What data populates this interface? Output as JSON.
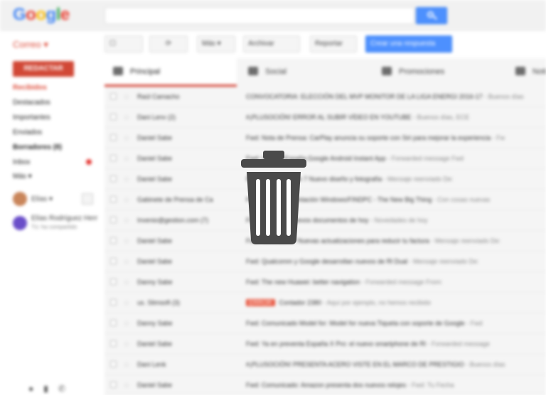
{
  "header": {
    "logo": "Google",
    "search_placeholder": ""
  },
  "toolbar": {
    "app_switch": "Correo ▾",
    "select": "☐",
    "refresh": "⟳",
    "more": "Más ▾",
    "archive": "Archivar",
    "report": "Reportar",
    "action": "Crear una respuesta"
  },
  "sidebar": {
    "compose": "REDACTAR",
    "items": [
      "Recibidos",
      "Destacados",
      "Importantes",
      "Enviados",
      "Borradores (8)",
      "Inbox",
      "Más ▾"
    ]
  },
  "hangouts": {
    "me": "Elías ▾",
    "contact_line1": "Elías Rodríguez Herr",
    "contact_line2": "Tú: ha compartido"
  },
  "tabs": [
    {
      "label": "Principal"
    },
    {
      "label": "Social"
    },
    {
      "label": "Promociones"
    },
    {
      "label": "Noti"
    }
  ],
  "emails": [
    {
      "sender": "Raúl Camacho",
      "subject": "CONVOCATORIA: ELECCIÓN DEL MVP MONITOR DE LA LIGA ENERGI 2016-17",
      "snippet": " - Buenos días",
      "label": ""
    },
    {
      "sender": "Dani Lenv (2)",
      "subject": "#¡PLUSOCIÓN! ERROR AL SUBIR VÍDEO EN YOUTUBE",
      "snippet": " - Buenos días, ECE",
      "label": ""
    },
    {
      "sender": "Daniel Sabe",
      "subject": "Fwd: Nota de Prensa: CarPlay anuncia su soporte con Siri para mejorar la experiencia",
      "snippet": " - Fw",
      "label": ""
    },
    {
      "sender": "Daniel Sabe",
      "subject": "Fwd: Llega a España Google Android Instant App",
      "snippet": " - Forwarded message Fwd",
      "label": ""
    },
    {
      "sender": "Daniel Sabe",
      "subject": "Fwd: Nuevo iPhone 7 Nuevo diseño y fotografía",
      "snippet": " - Mensaje reenviado De:",
      "label": ""
    },
    {
      "sender": "Gabinete de Prensa de Ca",
      "subject": "Fwd: Nueva presentación Windows/FINDPC - The New Big Thing",
      "snippet": " - Con cosas nuevas",
      "label": ""
    },
    {
      "sender": "Invenio@gestion.com (7)",
      "subject": "Fwd: Todos los nuevos documentos de hoy",
      "snippet": " - Novedades de hoy",
      "label": ""
    },
    {
      "sender": "Daniel Sabe",
      "subject": "Fwd: Novedades: Nuevas actualizaciones para reducir tu factura",
      "snippet": " - Mensaje reenviado De:",
      "label": ""
    },
    {
      "sender": "Daniel Sabe",
      "subject": "Fwd: Qualcomm y Google desarrollan nuevos de Rl Dual",
      "snippet": " - Mensaje reenviado De:",
      "label": ""
    },
    {
      "sender": "Danny Sabe",
      "subject": "Fwd: The new Huawei: better navigation",
      "snippet": " - Forwarded message From:",
      "label": ""
    },
    {
      "sender": "us. Slimsoft (3)",
      "subject": "Contador 2380",
      "snippet": " - Aquí por ejemplo, no hemos recibido",
      "label": "ERROR"
    },
    {
      "sender": "Danny Sabe",
      "subject": "Fwd: Comunicado Model for: Model for nueva Tiqueta con soporte de Google",
      "snippet": " - Fwd",
      "label": ""
    },
    {
      "sender": "Daniel Sabe",
      "subject": "Fwd: Ya en preventa España X Pro: el nuevo smartphone de Rl",
      "snippet": " - Forwarded message",
      "label": ""
    },
    {
      "sender": "Dani Lenk",
      "subject": "#¡PLUSOCIÓN! PRESENTA ACERO VISTE EN EL MARCO DE PRESTIGIO",
      "snippet": " - Buenos días",
      "label": ""
    },
    {
      "sender": "Daniel Sabe",
      "subject": "Fwd: Comunicado: Amazon presenta dos nuevos relojes",
      "snippet": " - Fwd: Tu Fecha",
      "label": ""
    }
  ]
}
